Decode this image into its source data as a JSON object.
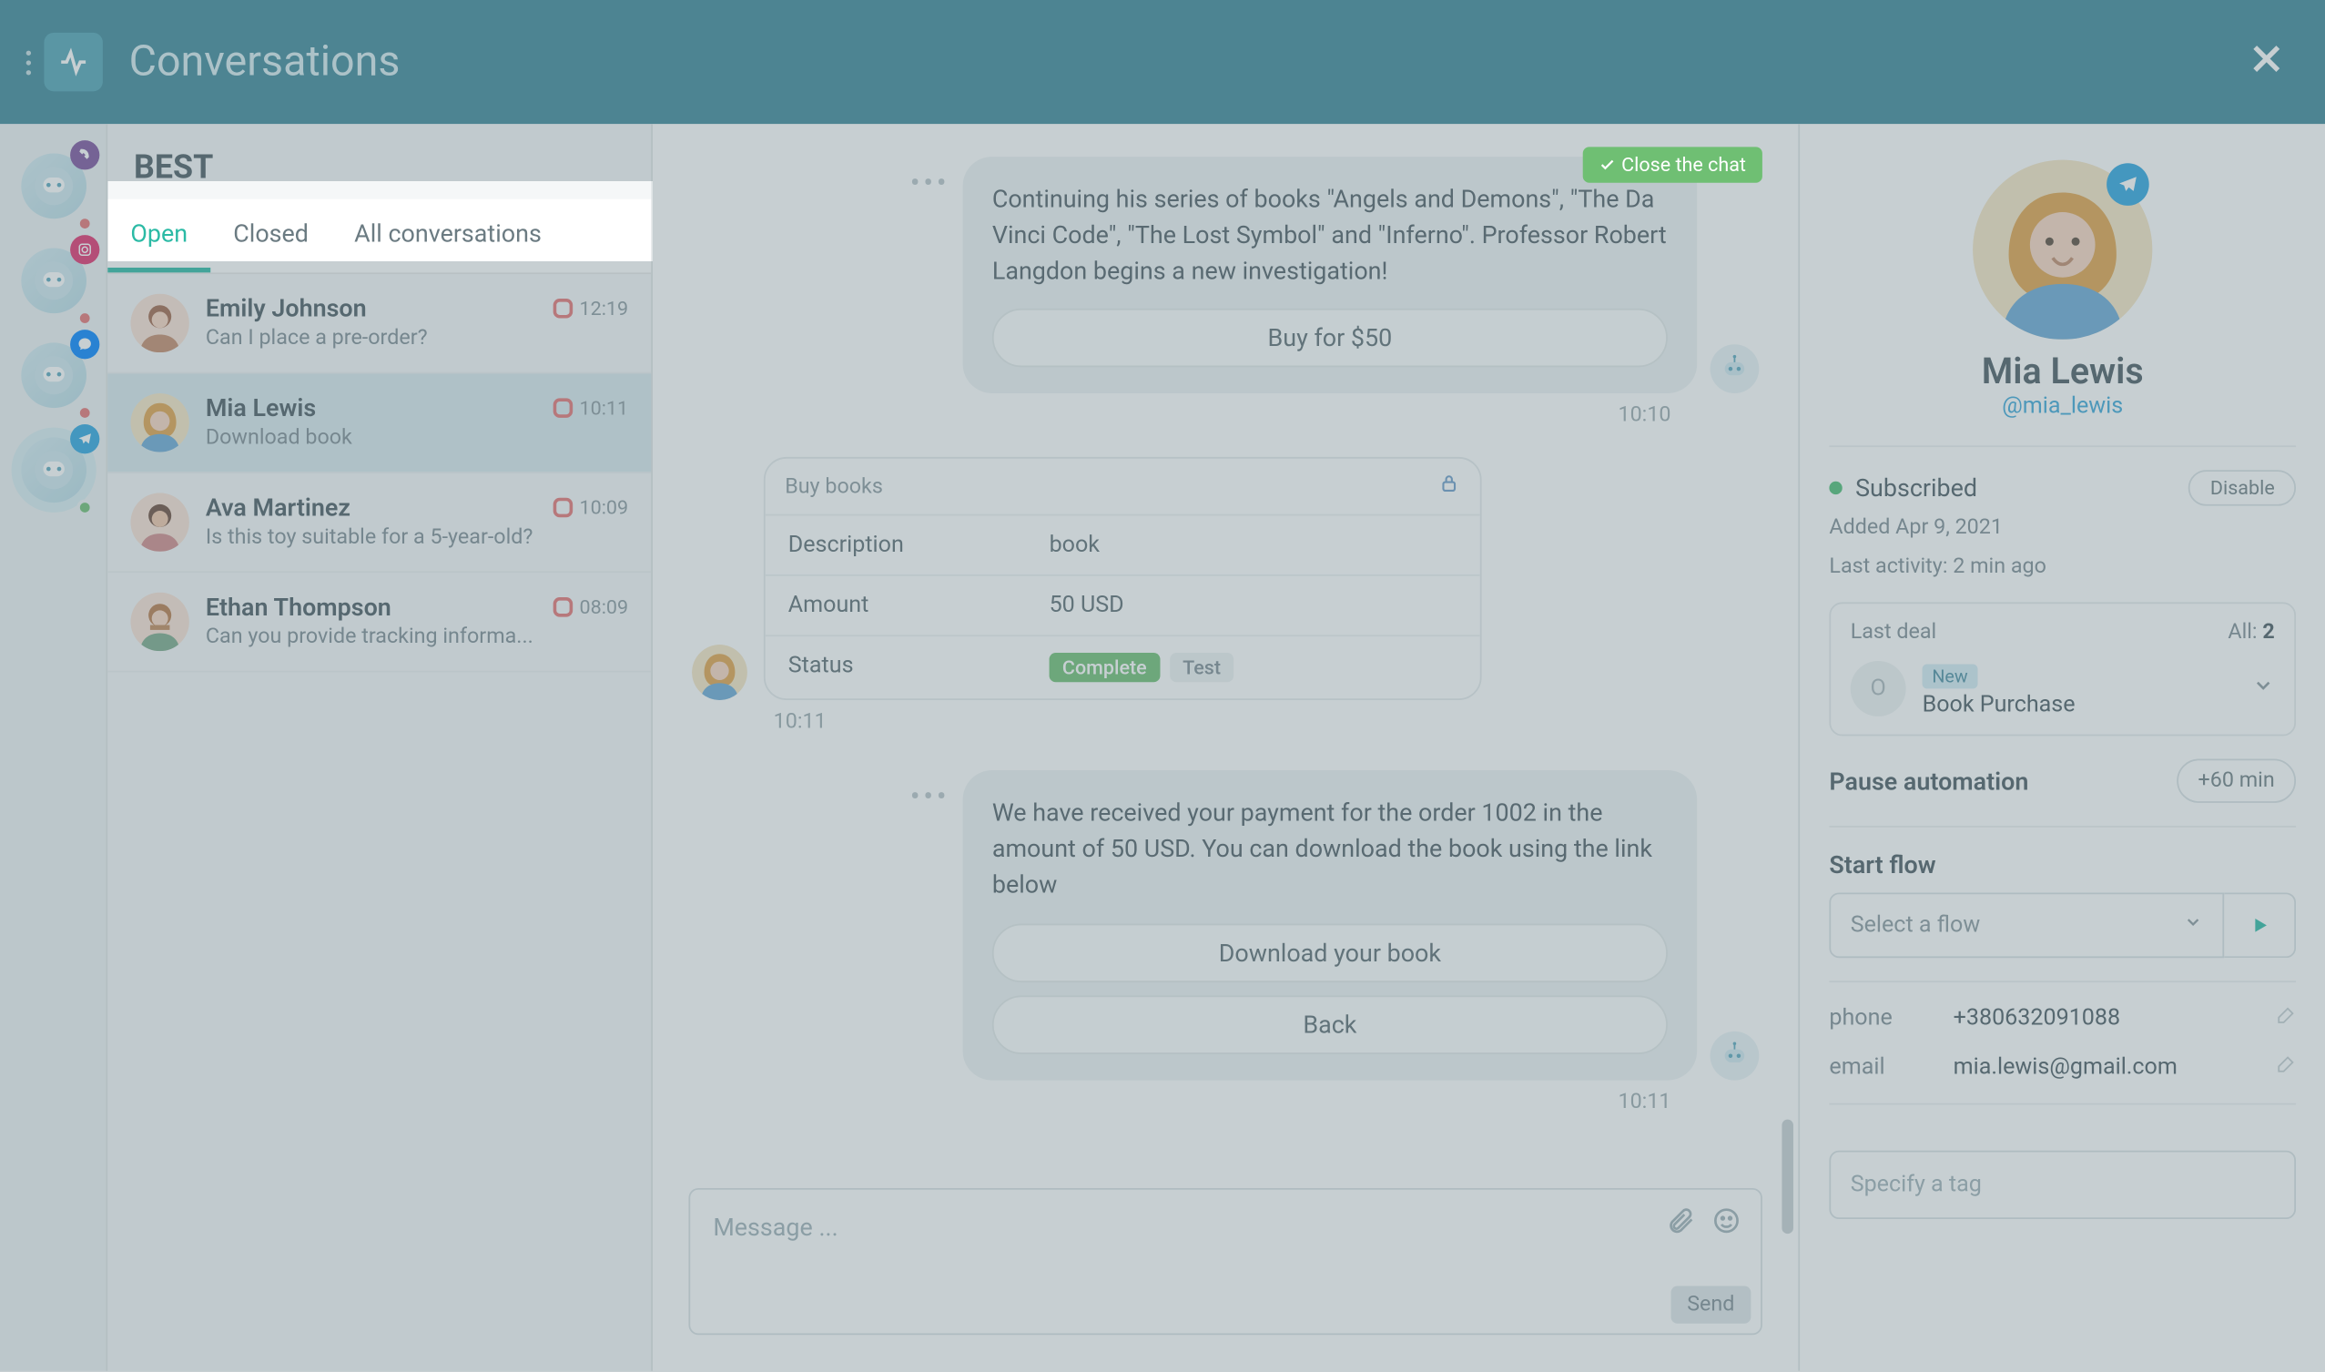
{
  "header": {
    "title": "Conversations"
  },
  "rail": [
    {
      "net": "viber"
    },
    {
      "net": "instagram"
    },
    {
      "net": "messenger"
    },
    {
      "net": "telegram"
    }
  ],
  "list": {
    "heading": "BEST",
    "tabs": {
      "open": "Open",
      "closed": "Closed",
      "all": "All conversations"
    },
    "items": [
      {
        "name": "Emily Johnson",
        "preview": "Can I place a pre-order?",
        "time": "12:19"
      },
      {
        "name": "Mia Lewis",
        "preview": "Download book",
        "time": "10:11"
      },
      {
        "name": "Ava Martinez",
        "preview": "Is this toy suitable for a 5-year-old?",
        "time": "10:09"
      },
      {
        "name": "Ethan Thompson",
        "preview": "Can you provide tracking informa...",
        "time": "08:09"
      }
    ]
  },
  "chat": {
    "close_label": "Close the chat",
    "msg1_text": "Continuing his series of books \"Angels and Demons\", \"The Da Vinci Code\", \"The Lost Symbol\" and \"Inferno\". Professor Robert Langdon begins a new investigation!",
    "msg1_btn": "Buy for $50",
    "msg1_time": "10:10",
    "card": {
      "title": "Buy books",
      "rows": {
        "desc_k": "Description",
        "desc_v": "book",
        "amt_k": "Amount",
        "amt_v": "50 USD",
        "st_k": "Status",
        "st_complete": "Complete",
        "st_test": "Test"
      },
      "time": "10:11"
    },
    "msg2_text": "We have received your payment for the order 1002 in the amount of 50 USD. You can download the book using the link below",
    "msg2_btn1": "Download your book",
    "msg2_btn2": "Back",
    "msg2_time": "10:11",
    "composer_placeholder": "Message ...",
    "send": "Send"
  },
  "profile": {
    "name": "Mia Lewis",
    "handle": "@mia_lewis",
    "subscribed": "Subscribed",
    "disable": "Disable",
    "added": "Added Apr 9, 2021",
    "activity": "Last activity: 2 min ago",
    "deal": {
      "last": "Last deal",
      "all_label": "All: ",
      "all_count": "2",
      "new": "New",
      "name": "Book Purchase",
      "initial": "O"
    },
    "pause": "Pause automation",
    "plus60": "+60 min",
    "flow_label": "Start flow",
    "flow_placeholder": "Select a flow",
    "phone_k": "phone",
    "phone_v": "+380632091088",
    "email_k": "email",
    "email_v": "mia.lewis@gmail.com",
    "tag_placeholder": "Specify a tag"
  }
}
